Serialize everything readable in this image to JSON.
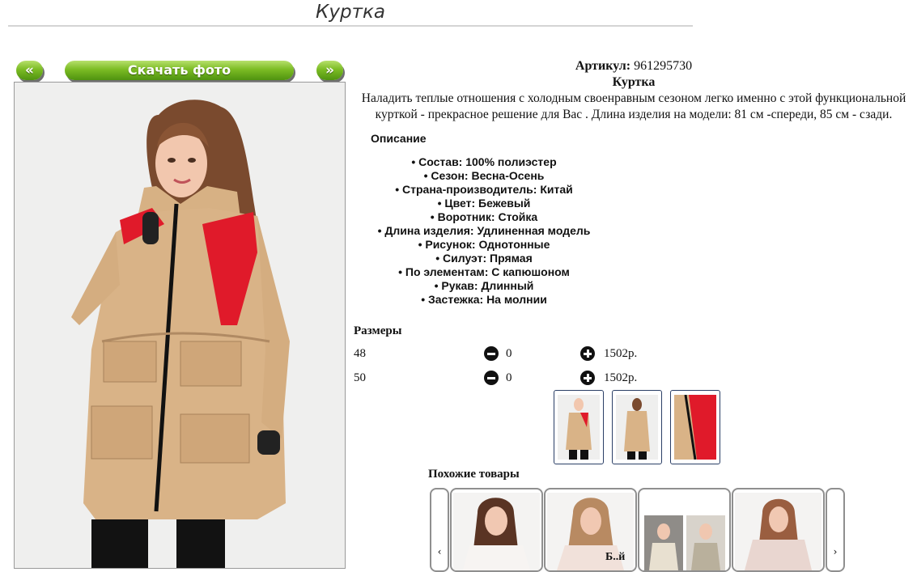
{
  "page": {
    "title": "Куртка"
  },
  "gallery": {
    "prev_label": "«",
    "download_label": "Скачать фото",
    "next_label": "»"
  },
  "product": {
    "sku_label": "Артикул:",
    "sku_value": "961295730",
    "name": "Куртка",
    "description": "Наладить теплые отношения с холодным своенравным сезоном легко именно с этой функциональной курткой - прекрасное решение для Вас . Длина изделия на модели: 81 см -спереди, 85 см - сзади.",
    "description_heading": "Описание",
    "features": [
      "Состав: 100% полиэстер",
      "Сезон: Весна-Осень",
      "Страна-производитель: Китай",
      "Цвет: Бежевый",
      "Воротник: Стойка",
      "Длина изделия: Удлиненная модель",
      "Рисунок: Однотонные",
      "Силуэт: Прямая",
      "По элементам: С капюшоном",
      "Рукав: Длинный",
      "Застежка: На молнии"
    ],
    "colors": {
      "jacket": "#d9b387",
      "accent": "#e01a2a"
    }
  },
  "sizes": {
    "heading": "Размеры",
    "rows": [
      {
        "size": "48",
        "qty": "0",
        "price": "1502р."
      },
      {
        "size": "50",
        "qty": "0",
        "price": "1502р."
      }
    ]
  },
  "similar": {
    "heading": "Похожие товары",
    "prev_label": "‹",
    "next_label": "›",
    "partial_text": "Б..й"
  },
  "icons": [
    "minus-circle-icon",
    "plus-circle-icon"
  ]
}
